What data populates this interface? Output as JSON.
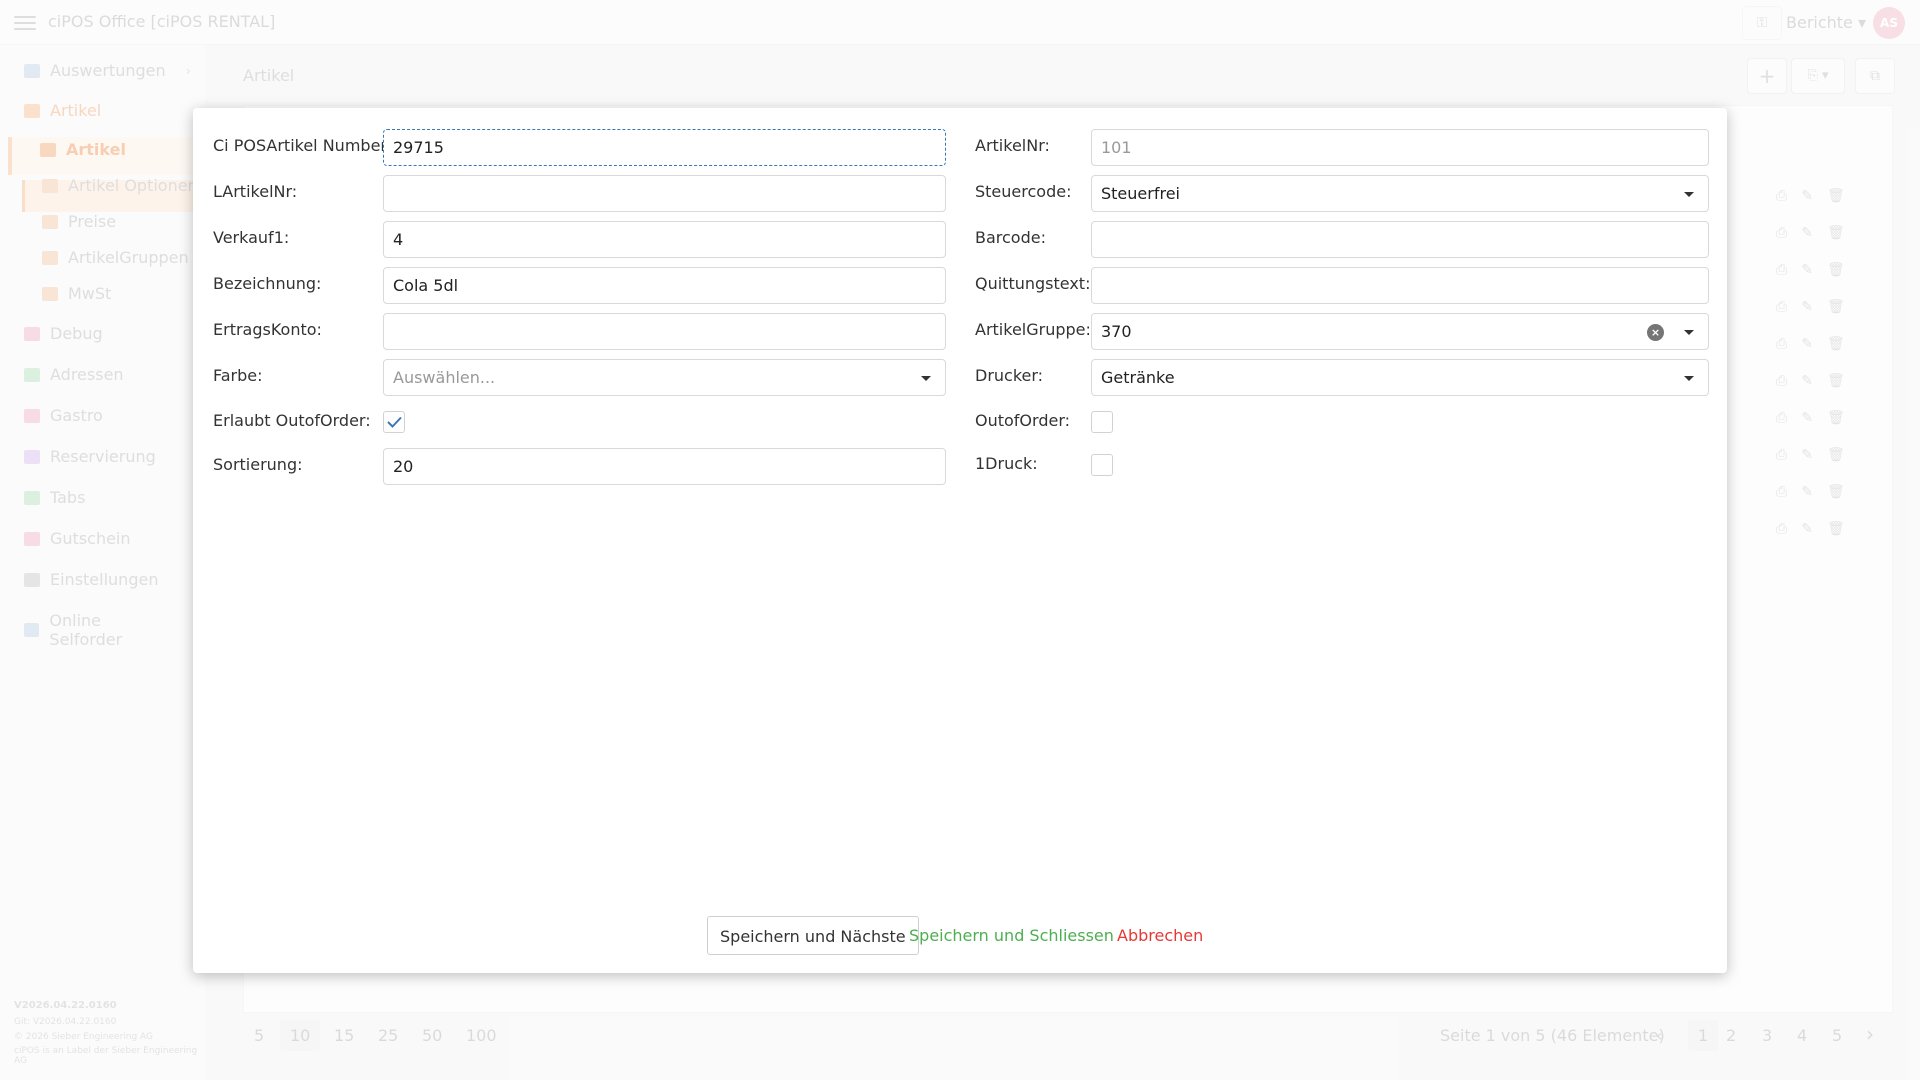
{
  "app": {
    "title": "ciPOS Office [ciPOS RENTAL]",
    "reports_label": "Berichte",
    "avatar": "AS"
  },
  "sidebar": {
    "items": [
      {
        "label": "Auswertungen",
        "icon": "chart-icon"
      },
      {
        "label": "Artikel",
        "icon": "tag-icon"
      },
      {
        "label": "Artikel",
        "icon": "box-icon"
      },
      {
        "label": "Artikel Optionen",
        "icon": "list-icon"
      },
      {
        "label": "Preise",
        "icon": "euro-icon"
      },
      {
        "label": "ArtikelGruppen",
        "icon": "layers-icon"
      },
      {
        "label": "MwSt",
        "icon": "percent-icon"
      },
      {
        "label": "Debug",
        "icon": "bug-icon"
      },
      {
        "label": "Adressen",
        "icon": "address-icon"
      },
      {
        "label": "Gastro",
        "icon": "cutlery-icon"
      },
      {
        "label": "Reservierung",
        "icon": "calendar-icon"
      },
      {
        "label": "Tabs",
        "icon": "grid-icon"
      },
      {
        "label": "Gutschein",
        "icon": "gift-icon"
      },
      {
        "label": "Einstellungen",
        "icon": "gear-icon"
      },
      {
        "label": "Online Selforder",
        "icon": "cart-icon"
      }
    ],
    "version": "V2026.04.22.0160",
    "version_sub1": "Git: V2026.04.22.0160",
    "version_sub2": "© 2026 Sieber Engineering AG",
    "version_sub3": "ciPOS is an Label der Sieber Engineering AG"
  },
  "content": {
    "title": "Artikel",
    "pager": {
      "sizes": [
        "5",
        "10",
        "15",
        "25",
        "50",
        "100"
      ],
      "info": "Seite 1 von 5 (46 Elemente)",
      "pages": [
        "1",
        "2",
        "3",
        "4",
        "5"
      ]
    }
  },
  "form": {
    "left": {
      "ci_number_label": "Ci POSArtikel Number:",
      "ci_number_value": "29715",
      "lartikelnr_label": "LArtikelNr:",
      "lartikelnr_value": "",
      "verkauf_label": "Verkauf1:",
      "verkauf_value": "4",
      "bezeichnung_label": "Bezeichnung:",
      "bezeichnung_value": "Cola 5dl",
      "ertragskonto_label": "ErtragsKonto:",
      "ertragskonto_value": "",
      "farbe_label": "Farbe:",
      "farbe_placeholder": "Auswählen...",
      "erlaubt_label": "Erlaubt OutofOrder:",
      "erlaubt_checked": true,
      "sortierung_label": "Sortierung:",
      "sortierung_value": "20"
    },
    "right": {
      "artikelnr_label": "ArtikelNr:",
      "artikelnr_value": "101",
      "steuercode_label": "Steuercode:",
      "steuercode_value": "Steuerfrei",
      "barcode_label": "Barcode:",
      "barcode_value": "",
      "quittung_label": "Quittungstext:",
      "quittung_value": "",
      "gruppe_label": "ArtikelGruppe:",
      "gruppe_value": "370",
      "drucker_label": "Drucker:",
      "drucker_value": "Getränke",
      "outoforder_label": "OutofOrder:",
      "outoforder_checked": false,
      "druck1_label": "1Druck:",
      "druck1_checked": false
    },
    "buttons": {
      "save_next": "Speichern und Nächste",
      "save_close": "Speichern und Schliessen",
      "cancel": "Abbrechen"
    }
  }
}
